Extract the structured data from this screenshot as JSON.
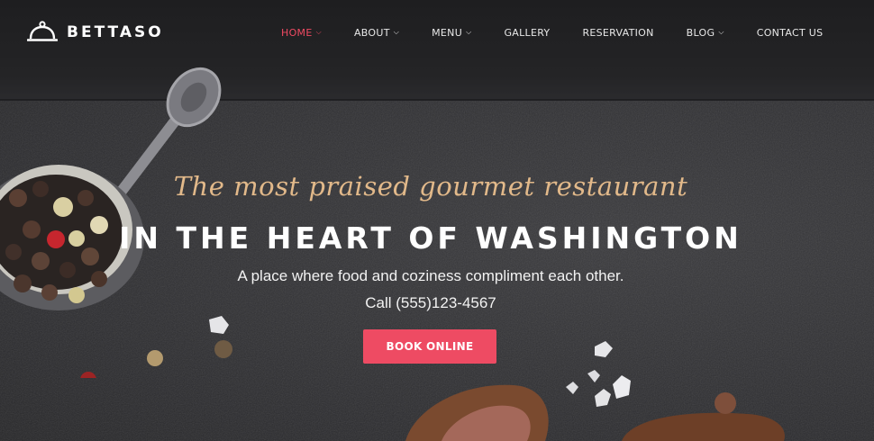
{
  "brand": {
    "logo_icon": "cloche-icon",
    "name": "BETTASO"
  },
  "nav": {
    "items": [
      {
        "label": "HOME",
        "dropdown": true,
        "active": true
      },
      {
        "label": "ABOUT",
        "dropdown": true,
        "active": false
      },
      {
        "label": "MENU",
        "dropdown": true,
        "active": false
      },
      {
        "label": "GALLERY",
        "dropdown": false,
        "active": false
      },
      {
        "label": "RESERVATION",
        "dropdown": false,
        "active": false
      },
      {
        "label": "BLOG",
        "dropdown": true,
        "active": false
      },
      {
        "label": "CONTACT US",
        "dropdown": false,
        "active": false
      }
    ]
  },
  "hero": {
    "tagline": "The most praised gourmet restaurant",
    "headline": "IN THE HEART OF WASHINGTON",
    "subline": "A place where food and coziness compliment each other.",
    "phone": "Call (555)123-4567",
    "cta_label": "BOOK ONLINE"
  },
  "colors": {
    "accent": "#ee4b63",
    "tagline": "#e2b98a",
    "nav_active": "#ef4a62",
    "background": "#2e2e31"
  }
}
